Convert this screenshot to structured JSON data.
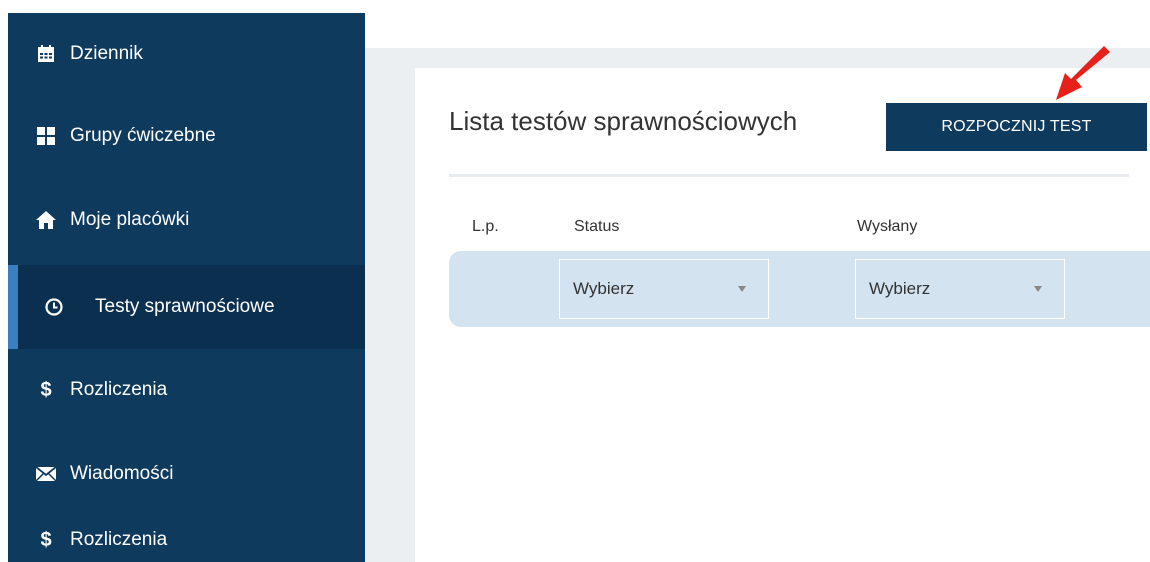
{
  "sidebar": {
    "items": [
      {
        "label": "Dziennik",
        "icon": "calendar-icon"
      },
      {
        "label": "Grupy ćwiczebne",
        "icon": "grid-icon"
      },
      {
        "label": "Moje placówki",
        "icon": "home-icon"
      },
      {
        "label": "Testy sprawnościowe",
        "icon": "clock-icon",
        "active": true
      },
      {
        "label": "Rozliczenia",
        "icon": "dollar-icon"
      },
      {
        "label": "Wiadomości",
        "icon": "envelope-icon"
      },
      {
        "label": "Rozliczenia",
        "icon": "dollar-icon"
      }
    ]
  },
  "main": {
    "title": "Lista testów sprawnościowych",
    "start_button": "ROZPOCZNIJ TEST",
    "table": {
      "headers": [
        "L.p.",
        "Status",
        "Wysłany"
      ],
      "filters": {
        "status": {
          "value": "Wybierz"
        },
        "sent": {
          "value": "Wybierz"
        }
      }
    }
  },
  "colors": {
    "sidebar_bg": "#0e3a5e",
    "sidebar_active_bg": "#0b304f",
    "active_indicator": "#3a7fc0",
    "button_bg": "#0e3a5e",
    "filter_row_bg": "#d3e3ef",
    "arrow": "#e8201a"
  }
}
